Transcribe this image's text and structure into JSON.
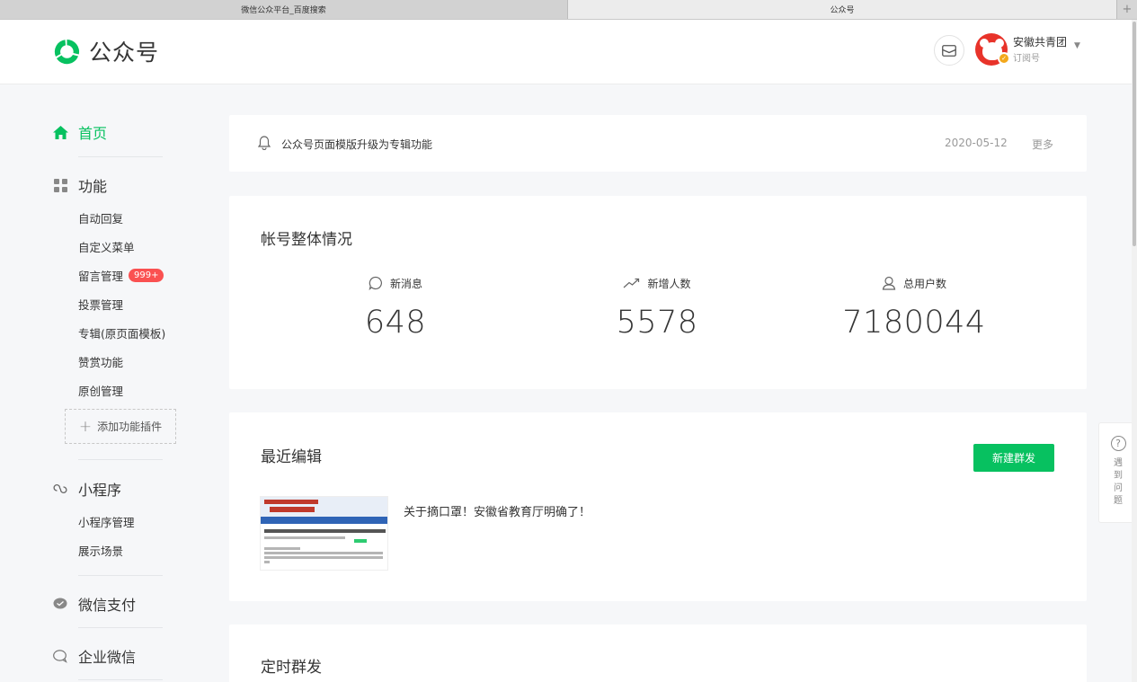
{
  "browser": {
    "tabs": [
      {
        "label": "微信公众平台_百度搜索",
        "active": false
      },
      {
        "label": "公众号",
        "active": true
      }
    ],
    "new_tab_symbol": "+"
  },
  "header": {
    "logo_text": "公众号",
    "account_name": "安徽共青团",
    "account_type": "订阅号",
    "mail_icon": "mail-icon"
  },
  "sidebar": {
    "home": "首页",
    "features": {
      "label": "功能",
      "items": [
        "自动回复",
        "自定义菜单",
        "留言管理",
        "投票管理",
        "专辑(原页面模板)",
        "赞赏功能",
        "原创管理"
      ],
      "message_badge": "999+",
      "add_plugin": "添加功能插件"
    },
    "mini_program": {
      "label": "小程序",
      "items": [
        "小程序管理",
        "展示场景"
      ]
    },
    "wechat_pay": "微信支付",
    "enterprise_wechat": "企业微信"
  },
  "notice": {
    "text": "公众号页面模版升级为专辑功能",
    "date": "2020-05-12",
    "more": "更多"
  },
  "overview": {
    "title": "帐号整体情况",
    "stats": [
      {
        "label": "新消息",
        "value": "648",
        "icon": "message-icon"
      },
      {
        "label": "新增人数",
        "value": "5578",
        "icon": "trend-icon"
      },
      {
        "label": "总用户数",
        "value": "7180044",
        "icon": "user-icon"
      }
    ]
  },
  "recent": {
    "title": "最近编辑",
    "new_button": "新建群发",
    "article_title": "关于摘口罩！安徽省教育厅明确了！"
  },
  "scheduled": {
    "title": "定时群发"
  },
  "help": {
    "icon": "?",
    "text": "遇到问题"
  },
  "colors": {
    "brand_green": "#07c160",
    "badge_red": "#fa5151",
    "background": "#f6f7f9"
  }
}
